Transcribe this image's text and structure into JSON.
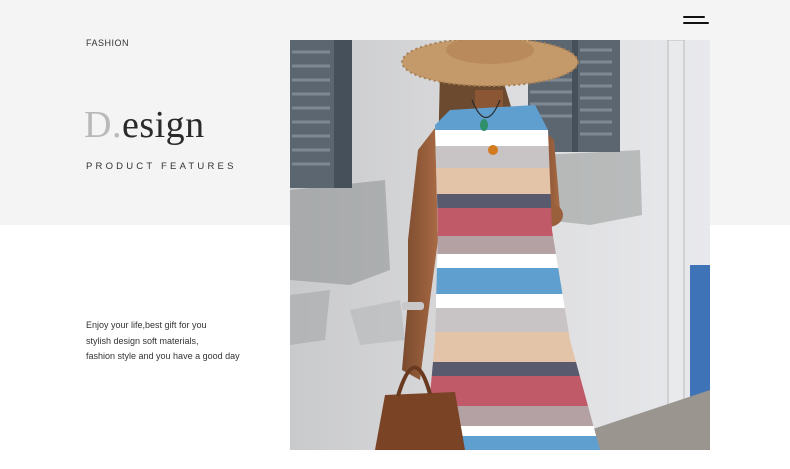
{
  "header": {
    "category": "FASHION",
    "menu_icon": "hamburger-menu-icon"
  },
  "hero": {
    "title_initial": "D.",
    "title_rest": "esign",
    "subtitle": "PRODUCT FEATURES"
  },
  "description": {
    "lines": [
      "Enjoy your life,best gift for you",
      "stylish design soft materials,",
      "fashion style and you have a good day"
    ]
  },
  "photo": {
    "subject": "woman in striped sleeveless dress with straw hat and brown tote bag",
    "stripe_colors": [
      "#5f9fd0",
      "#ffffff",
      "#c8c3c4",
      "#e4c4a8",
      "#5a5a6e",
      "#c05a68",
      "#b4a1a3",
      "#5f9fd0"
    ]
  }
}
